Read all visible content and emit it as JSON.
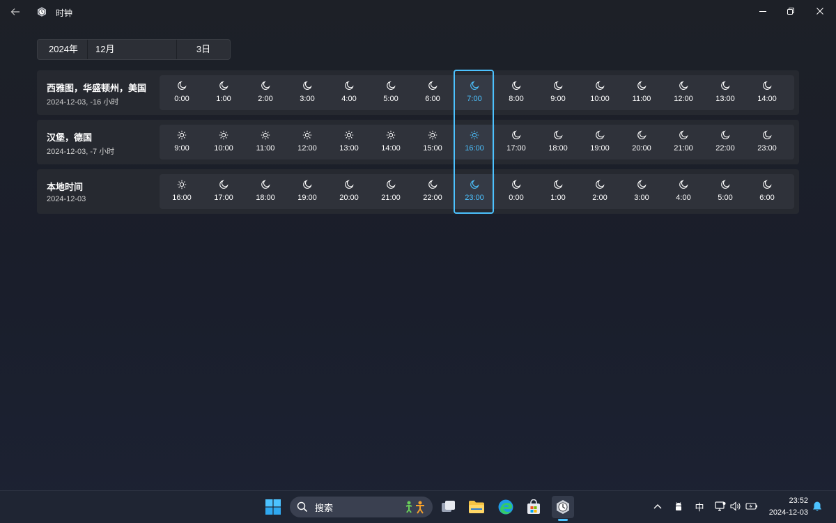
{
  "window": {
    "title": "时钟"
  },
  "date_picker": {
    "year": "2024年",
    "month": "12月",
    "day": "3日"
  },
  "rows": [
    {
      "city": "西雅图，华盛顿州，美国",
      "subtitle": "2024-12-03, -16 小时",
      "hours": [
        {
          "t": "0:00",
          "icon": "moon"
        },
        {
          "t": "1:00",
          "icon": "moon"
        },
        {
          "t": "2:00",
          "icon": "moon"
        },
        {
          "t": "3:00",
          "icon": "moon"
        },
        {
          "t": "4:00",
          "icon": "moon"
        },
        {
          "t": "5:00",
          "icon": "moon"
        },
        {
          "t": "6:00",
          "icon": "moon"
        },
        {
          "t": "7:00",
          "icon": "moon"
        },
        {
          "t": "8:00",
          "icon": "moon"
        },
        {
          "t": "9:00",
          "icon": "moon"
        },
        {
          "t": "10:00",
          "icon": "moon"
        },
        {
          "t": "11:00",
          "icon": "moon"
        },
        {
          "t": "12:00",
          "icon": "moon"
        },
        {
          "t": "13:00",
          "icon": "moon"
        },
        {
          "t": "14:00",
          "icon": "moon"
        }
      ]
    },
    {
      "city": "汉堡，德国",
      "subtitle": "2024-12-03, -7 小时",
      "hours": [
        {
          "t": "9:00",
          "icon": "sun"
        },
        {
          "t": "10:00",
          "icon": "sun"
        },
        {
          "t": "11:00",
          "icon": "sun"
        },
        {
          "t": "12:00",
          "icon": "sun"
        },
        {
          "t": "13:00",
          "icon": "sun"
        },
        {
          "t": "14:00",
          "icon": "sun"
        },
        {
          "t": "15:00",
          "icon": "sun"
        },
        {
          "t": "16:00",
          "icon": "sun"
        },
        {
          "t": "17:00",
          "icon": "moon"
        },
        {
          "t": "18:00",
          "icon": "moon"
        },
        {
          "t": "19:00",
          "icon": "moon"
        },
        {
          "t": "20:00",
          "icon": "moon"
        },
        {
          "t": "21:00",
          "icon": "moon"
        },
        {
          "t": "22:00",
          "icon": "moon"
        },
        {
          "t": "23:00",
          "icon": "moon"
        }
      ]
    },
    {
      "city": "本地时间",
      "subtitle": "2024-12-03",
      "hours": [
        {
          "t": "16:00",
          "icon": "sun"
        },
        {
          "t": "17:00",
          "icon": "moon"
        },
        {
          "t": "18:00",
          "icon": "moon"
        },
        {
          "t": "19:00",
          "icon": "moon"
        },
        {
          "t": "20:00",
          "icon": "moon"
        },
        {
          "t": "21:00",
          "icon": "moon"
        },
        {
          "t": "22:00",
          "icon": "moon"
        },
        {
          "t": "23:00",
          "icon": "moon"
        },
        {
          "t": "0:00",
          "icon": "moon"
        },
        {
          "t": "1:00",
          "icon": "moon"
        },
        {
          "t": "2:00",
          "icon": "moon"
        },
        {
          "t": "3:00",
          "icon": "moon"
        },
        {
          "t": "4:00",
          "icon": "moon"
        },
        {
          "t": "5:00",
          "icon": "moon"
        },
        {
          "t": "6:00",
          "icon": "moon"
        }
      ]
    }
  ],
  "selected_hour_index": 7,
  "colors": {
    "accent": "#4cc2ff"
  },
  "taskbar": {
    "search_placeholder": "搜索",
    "ime": "中",
    "time": "23:52",
    "date": "2024-12-03"
  }
}
